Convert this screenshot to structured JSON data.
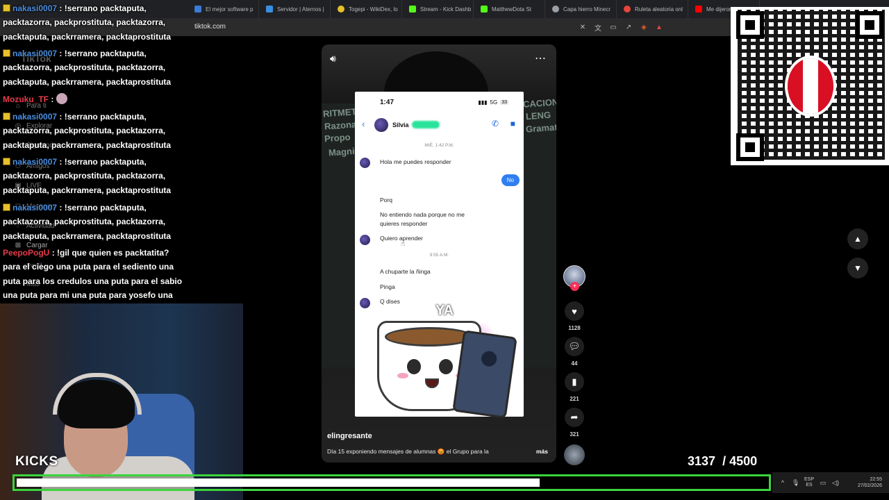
{
  "browser": {
    "url": "tiktok.com",
    "tabs": [
      {
        "label": "El mejor software p",
        "color": "#3a7bd5"
      },
      {
        "label": "Servidor | Aternos |",
        "color": "#3a8ee0"
      },
      {
        "label": "Togepi - WikiDex, lo",
        "color": "#e7c02a"
      },
      {
        "label": "Stream - Kick Dashb",
        "color": "#53fc18"
      },
      {
        "label": "MatthewDota St",
        "color": "#53fc18"
      },
      {
        "label": "Capa hierro Minecr",
        "color": "#9aa0a6"
      },
      {
        "label": "Ruleta aleatoria onl",
        "color": "#e8453c"
      },
      {
        "label": "Me dijeron que te v",
        "color": "#ff0000"
      }
    ]
  },
  "tiktok": {
    "logo": "TikTok",
    "sidebar": [
      "Para ti",
      "Explorar",
      "Siguiendo",
      "Amigos",
      "LIVE",
      "Mensajes",
      "Actividad",
      "Cargar",
      "Perfil",
      "Más"
    ],
    "video": {
      "username": "elingresante",
      "caption": "Día 15 exponiendo mensajes de alumnas 😡 el Grupo para la",
      "more_label": "más",
      "sticker_text": "YA",
      "chalk": [
        "RITMETICA",
        "Razona",
        "Propo",
        "Magnit",
        "CACION",
        "LENG",
        "Gramat"
      ]
    },
    "phone": {
      "time": "1:47",
      "network": "5G",
      "battery": "33",
      "contact": "Silvia",
      "date1": "MIÉ, 1:42 P.M.",
      "date2": "9:55 A.M.",
      "messages": {
        "m1": "Hola me puedes responder",
        "me": "No",
        "m2": "Porq",
        "m3": "No entiendo nada porque no me quieres responder",
        "m4": "Quiero aprender",
        "m5": "A chuparte la ñinga",
        "m6": "Pinga",
        "m7": "Q dises"
      }
    },
    "actions": {
      "likes": "1128",
      "comments": "44",
      "saves": "221",
      "shares": "321"
    }
  },
  "chat": [
    {
      "user": "nakasi0007",
      "text": ": !serrano packtaputa, packtazorra, packprostituta, packtazorra, packtaputa, packrramera, packtaprostituta",
      "badge": true
    },
    {
      "user": "nakasi0007",
      "text": ": !serrano packtaputa, packtazorra, packprostituta, packtazorra, packtaputa, packrramera, packtaprostituta",
      "badge": true
    },
    {
      "user": "Mozuku_TF",
      "text": ":",
      "badge": false,
      "red": true
    },
    {
      "user": "nakasi0007",
      "text": ": !serrano packtaputa, packtazorra, packprostituta, packtazorra, packtaputa, packrramera, packtaprostituta",
      "badge": true
    },
    {
      "user": "nakasi0007",
      "text": ": !serrano packtaputa, packtazorra, packprostituta, packtazorra, packtaputa, packrramera, packtaprostituta",
      "badge": true
    },
    {
      "user": "nakasi0007",
      "text": ": !serrano packtaputa, packtazorra, packprostituta, packtazorra, packtaputa, packrramera, packtaprostituta",
      "badge": true
    },
    {
      "user": "PeepoPogU",
      "text": ": !gil que quien es packtatita? para el ciego una puta para el sediento una puta para los credulos una puta para el sabio una puta para mi una puta para yosefo una perra para acosar",
      "badge": false,
      "red": true
    }
  ],
  "overlay": {
    "brand": "KICKS",
    "count_current": "3137",
    "count_total": "/ 4500",
    "progress": 0.697,
    "colors": {
      "progress_border": "#3bd43b",
      "flag_red": "#d91023"
    }
  },
  "taskbar": {
    "lang1": "ESP",
    "lang2": "ES",
    "time": "22:55",
    "date": "27/02/2026"
  }
}
